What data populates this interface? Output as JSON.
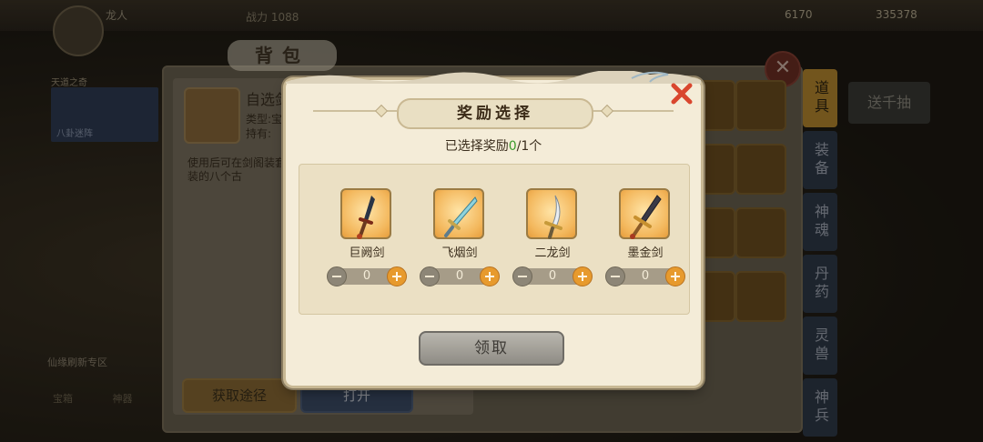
{
  "background": {
    "player_name": "龙人",
    "power_label": "战力",
    "power_value": "1088",
    "currency_1": "6170",
    "currency_2": "335378",
    "bag_title": "背包",
    "item": {
      "name": "自选剑",
      "type_label": "类型:宝",
      "owned_label": "持有:",
      "description": "使用后可在剑阁装套装的八个古"
    },
    "left_panel_title": "天道之奇",
    "left_panel_sub": "八卦迷阵",
    "tip_text": "仙缘刷新专区",
    "bottom_labels": [
      "宝箱",
      "神器"
    ],
    "buttons": {
      "source": "获取途径",
      "open": "打开"
    },
    "side_tabs": [
      "道具",
      "装备",
      "神魂",
      "丹药",
      "灵兽",
      "神兵"
    ],
    "right_banner": "送千抽"
  },
  "dialog": {
    "title": "奖励选择",
    "selected_prefix": "已选择奖励",
    "selected_count": "0",
    "selected_suffix": "/1个",
    "claim_label": "领取",
    "rewards": [
      {
        "name": "巨阙剑",
        "quantity": "0"
      },
      {
        "name": "飞烟剑",
        "quantity": "0"
      },
      {
        "name": "二龙剑",
        "quantity": "0"
      },
      {
        "name": "墨金剑",
        "quantity": "0"
      }
    ]
  },
  "colors": {
    "dialog_bg": "#f4ecd8",
    "accent_orange": "#e79a2d",
    "selected_green": "#3a9a2a",
    "close_red": "#d9462e"
  }
}
